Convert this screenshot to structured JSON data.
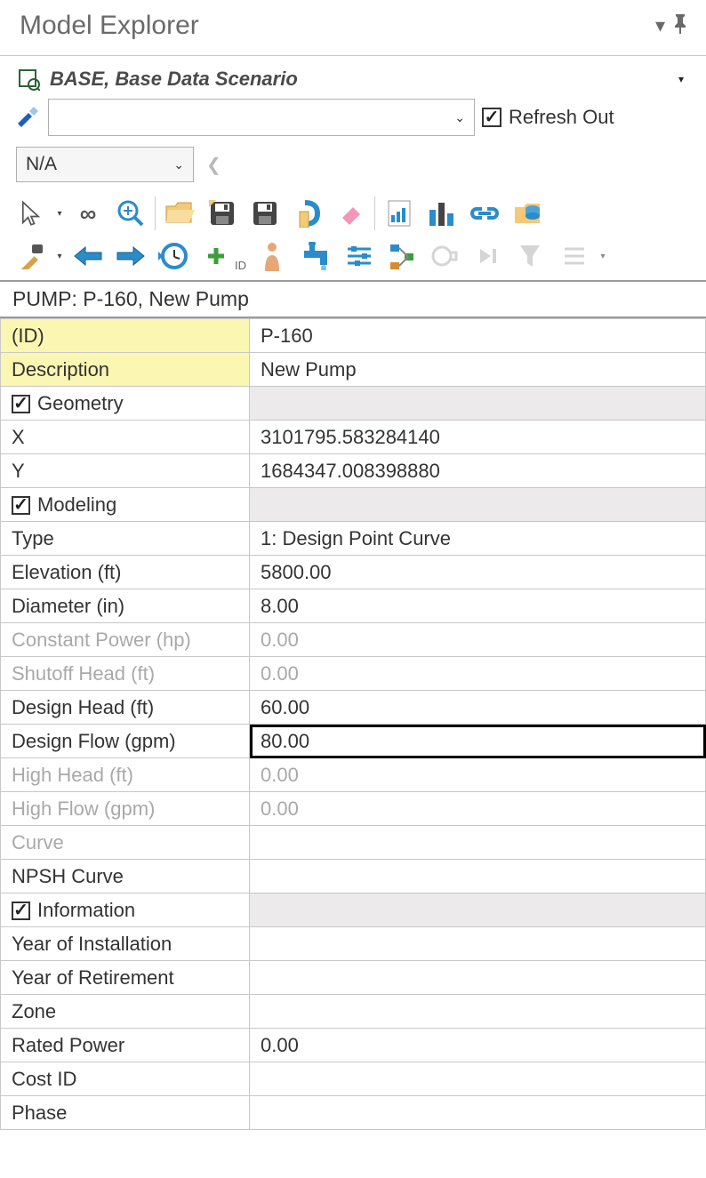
{
  "panel": {
    "title": "Model Explorer"
  },
  "scenario": {
    "label": "BASE, Base Data Scenario"
  },
  "refresh": {
    "label": "Refresh Out"
  },
  "na_combo": {
    "value": "N/A"
  },
  "block_header": "PUMP: P-160, New Pump",
  "sections": {
    "geometry": "Geometry",
    "modeling": "Modeling",
    "information": "Information"
  },
  "rows": {
    "id": {
      "label": "(ID)",
      "value": "P-160"
    },
    "description": {
      "label": "Description",
      "value": "New Pump"
    },
    "x": {
      "label": "X",
      "value": "3101795.583284140"
    },
    "y": {
      "label": "Y",
      "value": "1684347.008398880"
    },
    "type": {
      "label": "Type",
      "value": "1: Design Point Curve"
    },
    "elevation": {
      "label": "Elevation (ft)",
      "value": "5800.00"
    },
    "diameter": {
      "label": "Diameter (in)",
      "value": "8.00"
    },
    "constant_power": {
      "label": "Constant Power (hp)",
      "value": "0.00"
    },
    "shutoff_head": {
      "label": "Shutoff Head (ft)",
      "value": "0.00"
    },
    "design_head": {
      "label": "Design Head (ft)",
      "value": "60.00"
    },
    "design_flow": {
      "label": "Design Flow (gpm)",
      "value": "80.00"
    },
    "high_head": {
      "label": "High Head (ft)",
      "value": "0.00"
    },
    "high_flow": {
      "label": "High Flow (gpm)",
      "value": "0.00"
    },
    "curve": {
      "label": "Curve",
      "value": ""
    },
    "npsh_curve": {
      "label": "NPSH Curve",
      "value": ""
    },
    "year_install": {
      "label": "Year of Installation",
      "value": ""
    },
    "year_retire": {
      "label": "Year of Retirement",
      "value": ""
    },
    "zone": {
      "label": "Zone",
      "value": ""
    },
    "rated_power": {
      "label": "Rated Power",
      "value": "0.00"
    },
    "cost_id": {
      "label": "Cost ID",
      "value": ""
    },
    "phase": {
      "label": "Phase",
      "value": ""
    }
  }
}
